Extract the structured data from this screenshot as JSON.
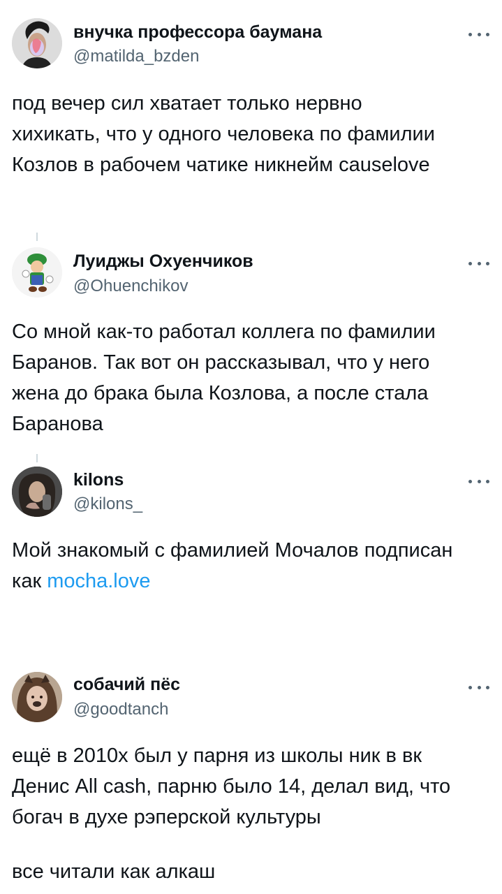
{
  "tweets": [
    {
      "name": "внучка профессора баумана",
      "handle": "@matilda_bzden",
      "lines": [
        "под вечер сил хватает только нервно",
        "хихикать, что у одного человека по фамилии",
        "Козлов в рабочем чатике никнейм causelove"
      ]
    },
    {
      "name": "Луиджы Охуенчиков",
      "handle": "@Ohuenchikov",
      "lines": [
        "Со мной как-то работал коллега по фамилии",
        "Баранов. Так вот он рассказывал, что у него",
        "жена до брака была Козлова, а после стала",
        "Баранова"
      ]
    },
    {
      "name": "kilons",
      "handle": "@kilons_",
      "line1": "Мой знакомый с фамилией Мочалов подписан",
      "line2_prefix": "как ",
      "line2_link": "mocha.love"
    },
    {
      "name": "собачий пёс",
      "handle": "@goodtanch",
      "lines": [
        "ещё в 2010х был у парня из школы ник в вк",
        "Денис All cash, парню было 14, делал вид, что",
        "богач в духе рэперской культуры"
      ],
      "last_line": "все читали как алкаш"
    }
  ],
  "icons": {
    "more": "more-horizontal-icon"
  },
  "colors": {
    "link": "#1d9bf0",
    "secondary": "#536471",
    "text": "#0f1419"
  }
}
